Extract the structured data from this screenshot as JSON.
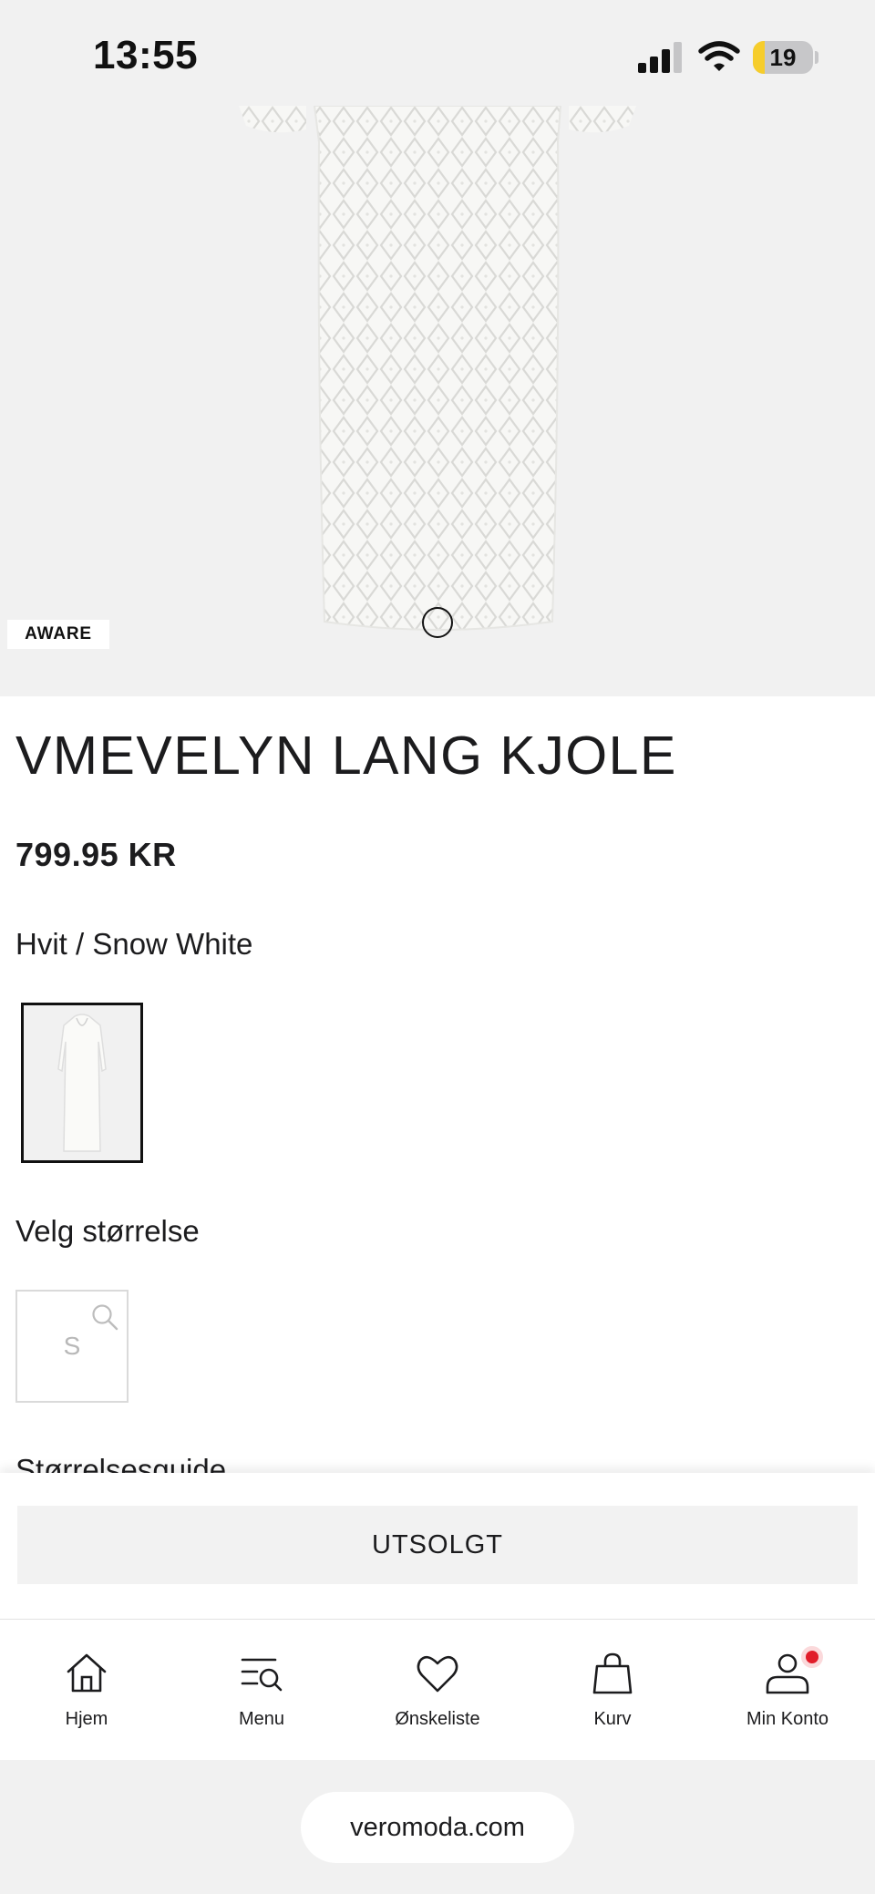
{
  "status_bar": {
    "time": "13:55",
    "battery_level": "19",
    "battery_fraction": 0.19,
    "signal_bars_active": 3
  },
  "product": {
    "badge": "AWARE",
    "title": "VMEVELYN LANG KJOLE",
    "price": "799.95 KR",
    "color_name": "Hvit / Snow White",
    "size_heading": "Velg størrelse",
    "sizes": [
      "S"
    ],
    "size_guide": "Størrelsesguide"
  },
  "buy_panel": {
    "button_label": "UTSOLGT"
  },
  "bottom_nav": {
    "items": [
      {
        "label": "Hjem",
        "icon": "home-icon"
      },
      {
        "label": "Menu",
        "icon": "menu-search-icon"
      },
      {
        "label": "Ønskeliste",
        "icon": "heart-icon"
      },
      {
        "label": "Kurv",
        "icon": "bag-icon"
      },
      {
        "label": "Min Konto",
        "icon": "account-icon"
      }
    ]
  },
  "browser": {
    "url": "veromoda.com"
  },
  "colors": {
    "background_gray": "#f1f1f1",
    "text": "#1c1c1e",
    "notification_red": "#e11d2a",
    "battery_yellow": "#f6cd2b"
  }
}
